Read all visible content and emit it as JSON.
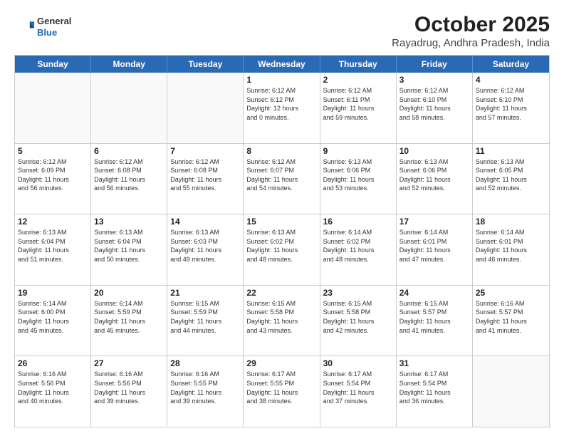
{
  "header": {
    "logo": {
      "general": "General",
      "blue": "Blue"
    },
    "title": "October 2025",
    "subtitle": "Rayadrug, Andhra Pradesh, India"
  },
  "calendar": {
    "days": [
      "Sunday",
      "Monday",
      "Tuesday",
      "Wednesday",
      "Thursday",
      "Friday",
      "Saturday"
    ],
    "weeks": [
      [
        {
          "day": "",
          "info": ""
        },
        {
          "day": "",
          "info": ""
        },
        {
          "day": "",
          "info": ""
        },
        {
          "day": "1",
          "info": "Sunrise: 6:12 AM\nSunset: 6:12 PM\nDaylight: 12 hours\nand 0 minutes."
        },
        {
          "day": "2",
          "info": "Sunrise: 6:12 AM\nSunset: 6:11 PM\nDaylight: 11 hours\nand 59 minutes."
        },
        {
          "day": "3",
          "info": "Sunrise: 6:12 AM\nSunset: 6:10 PM\nDaylight: 11 hours\nand 58 minutes."
        },
        {
          "day": "4",
          "info": "Sunrise: 6:12 AM\nSunset: 6:10 PM\nDaylight: 11 hours\nand 57 minutes."
        }
      ],
      [
        {
          "day": "5",
          "info": "Sunrise: 6:12 AM\nSunset: 6:09 PM\nDaylight: 11 hours\nand 56 minutes."
        },
        {
          "day": "6",
          "info": "Sunrise: 6:12 AM\nSunset: 6:08 PM\nDaylight: 11 hours\nand 56 minutes."
        },
        {
          "day": "7",
          "info": "Sunrise: 6:12 AM\nSunset: 6:08 PM\nDaylight: 11 hours\nand 55 minutes."
        },
        {
          "day": "8",
          "info": "Sunrise: 6:12 AM\nSunset: 6:07 PM\nDaylight: 11 hours\nand 54 minutes."
        },
        {
          "day": "9",
          "info": "Sunrise: 6:13 AM\nSunset: 6:06 PM\nDaylight: 11 hours\nand 53 minutes."
        },
        {
          "day": "10",
          "info": "Sunrise: 6:13 AM\nSunset: 6:06 PM\nDaylight: 11 hours\nand 52 minutes."
        },
        {
          "day": "11",
          "info": "Sunrise: 6:13 AM\nSunset: 6:05 PM\nDaylight: 11 hours\nand 52 minutes."
        }
      ],
      [
        {
          "day": "12",
          "info": "Sunrise: 6:13 AM\nSunset: 6:04 PM\nDaylight: 11 hours\nand 51 minutes."
        },
        {
          "day": "13",
          "info": "Sunrise: 6:13 AM\nSunset: 6:04 PM\nDaylight: 11 hours\nand 50 minutes."
        },
        {
          "day": "14",
          "info": "Sunrise: 6:13 AM\nSunset: 6:03 PM\nDaylight: 11 hours\nand 49 minutes."
        },
        {
          "day": "15",
          "info": "Sunrise: 6:13 AM\nSunset: 6:02 PM\nDaylight: 11 hours\nand 48 minutes."
        },
        {
          "day": "16",
          "info": "Sunrise: 6:14 AM\nSunset: 6:02 PM\nDaylight: 11 hours\nand 48 minutes."
        },
        {
          "day": "17",
          "info": "Sunrise: 6:14 AM\nSunset: 6:01 PM\nDaylight: 11 hours\nand 47 minutes."
        },
        {
          "day": "18",
          "info": "Sunrise: 6:14 AM\nSunset: 6:01 PM\nDaylight: 11 hours\nand 46 minutes."
        }
      ],
      [
        {
          "day": "19",
          "info": "Sunrise: 6:14 AM\nSunset: 6:00 PM\nDaylight: 11 hours\nand 45 minutes."
        },
        {
          "day": "20",
          "info": "Sunrise: 6:14 AM\nSunset: 5:59 PM\nDaylight: 11 hours\nand 45 minutes."
        },
        {
          "day": "21",
          "info": "Sunrise: 6:15 AM\nSunset: 5:59 PM\nDaylight: 11 hours\nand 44 minutes."
        },
        {
          "day": "22",
          "info": "Sunrise: 6:15 AM\nSunset: 5:58 PM\nDaylight: 11 hours\nand 43 minutes."
        },
        {
          "day": "23",
          "info": "Sunrise: 6:15 AM\nSunset: 5:58 PM\nDaylight: 11 hours\nand 42 minutes."
        },
        {
          "day": "24",
          "info": "Sunrise: 6:15 AM\nSunset: 5:57 PM\nDaylight: 11 hours\nand 41 minutes."
        },
        {
          "day": "25",
          "info": "Sunrise: 6:16 AM\nSunset: 5:57 PM\nDaylight: 11 hours\nand 41 minutes."
        }
      ],
      [
        {
          "day": "26",
          "info": "Sunrise: 6:16 AM\nSunset: 5:56 PM\nDaylight: 11 hours\nand 40 minutes."
        },
        {
          "day": "27",
          "info": "Sunrise: 6:16 AM\nSunset: 5:56 PM\nDaylight: 11 hours\nand 39 minutes."
        },
        {
          "day": "28",
          "info": "Sunrise: 6:16 AM\nSunset: 5:55 PM\nDaylight: 11 hours\nand 39 minutes."
        },
        {
          "day": "29",
          "info": "Sunrise: 6:17 AM\nSunset: 5:55 PM\nDaylight: 11 hours\nand 38 minutes."
        },
        {
          "day": "30",
          "info": "Sunrise: 6:17 AM\nSunset: 5:54 PM\nDaylight: 11 hours\nand 37 minutes."
        },
        {
          "day": "31",
          "info": "Sunrise: 6:17 AM\nSunset: 5:54 PM\nDaylight: 11 hours\nand 36 minutes."
        },
        {
          "day": "",
          "info": ""
        }
      ]
    ]
  }
}
